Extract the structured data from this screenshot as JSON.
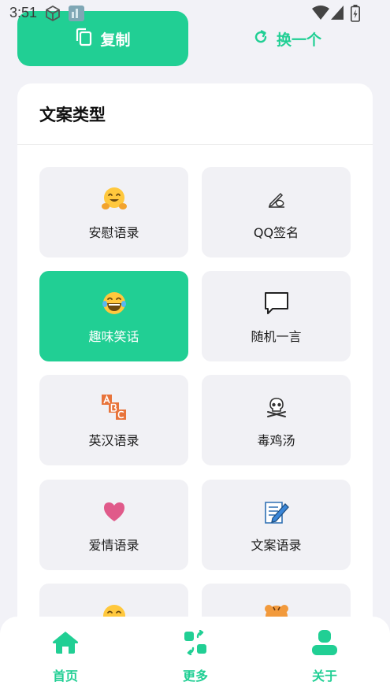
{
  "status_bar": {
    "time": "3:51",
    "icons": [
      "app-notification-icon",
      "app-notification-icon-2",
      "wifi-icon",
      "cell-signal-icon",
      "battery-icon"
    ]
  },
  "actions": {
    "copy_label": "复制",
    "refresh_label": "换一个"
  },
  "card": {
    "title": "文案类型",
    "categories": [
      {
        "label": "安慰语录",
        "icon": "hugging-face-icon",
        "selected": false
      },
      {
        "label": "QQ签名",
        "icon": "writing-hand-icon",
        "selected": false
      },
      {
        "label": "趣味笑话",
        "icon": "laughing-face-icon",
        "selected": true
      },
      {
        "label": "随机一言",
        "icon": "speech-bubble-icon",
        "selected": false
      },
      {
        "label": "英汉语录",
        "icon": "abc-blocks-icon",
        "selected": false
      },
      {
        "label": "毒鸡汤",
        "icon": "skull-crossbones-icon",
        "selected": false
      },
      {
        "label": "爱情语录",
        "icon": "heart-icon",
        "selected": false
      },
      {
        "label": "文案语录",
        "icon": "memo-pencil-icon",
        "selected": false
      },
      {
        "label": "",
        "icon": "smiling-face-icon",
        "selected": false
      },
      {
        "label": "",
        "icon": "tiger-face-icon",
        "selected": false
      }
    ]
  },
  "bottom_nav": {
    "items": [
      {
        "label": "首页",
        "icon": "home-icon"
      },
      {
        "label": "更多",
        "icon": "more-apps-icon"
      },
      {
        "label": "关于",
        "icon": "user-icon"
      }
    ]
  },
  "colors": {
    "accent": "#21cf94",
    "background": "#f2f2f7",
    "tile": "#f1f1f5"
  }
}
